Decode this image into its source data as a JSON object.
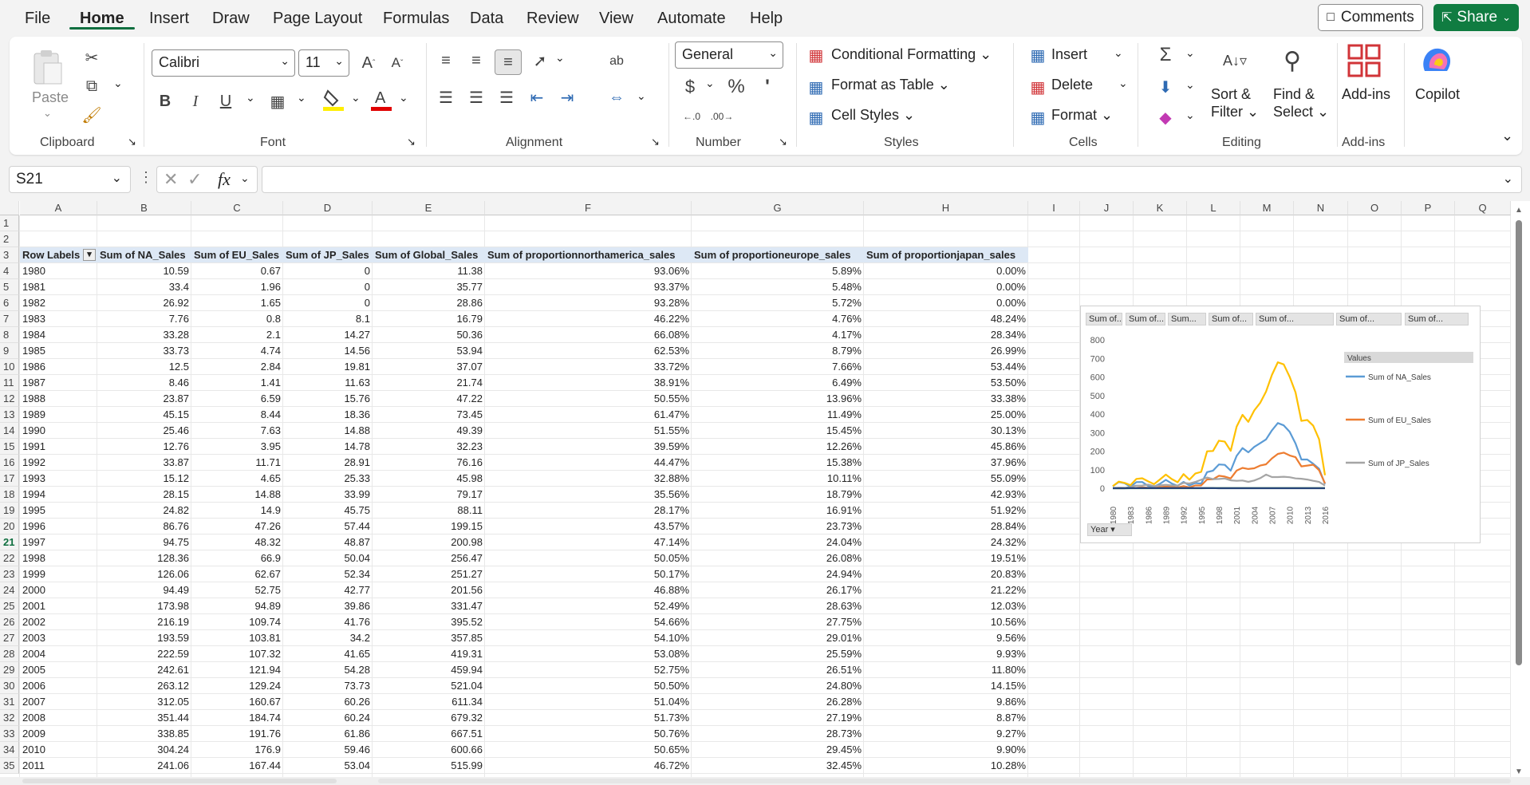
{
  "menu": {
    "tabs": [
      "File",
      "Home",
      "Insert",
      "Draw",
      "Page Layout",
      "Formulas",
      "Data",
      "Review",
      "View",
      "Automate",
      "Help"
    ],
    "active": "Home",
    "comments": "Comments",
    "share": "Share"
  },
  "ribbon": {
    "clipboard": {
      "paste": "Paste",
      "group": "Clipboard"
    },
    "font": {
      "name": "Calibri",
      "size": "11",
      "group": "Font"
    },
    "alignment": {
      "group": "Alignment"
    },
    "number": {
      "format": "General",
      "group": "Number"
    },
    "styles": {
      "conditional": "Conditional Formatting",
      "table": "Format as Table",
      "cell": "Cell Styles",
      "group": "Styles"
    },
    "cells": {
      "insert": "Insert",
      "delete": "Delete",
      "format": "Format",
      "group": "Cells"
    },
    "editing": {
      "sort1": "Sort &",
      "sort2": "Filter",
      "find1": "Find &",
      "find2": "Select",
      "group": "Editing"
    },
    "addins": {
      "label": "Add-ins",
      "group": "Add-ins"
    },
    "copilot": {
      "label": "Copilot"
    }
  },
  "formula_bar": {
    "name_box": "S21",
    "fx": "fx",
    "value": ""
  },
  "columns": [
    "A",
    "B",
    "C",
    "D",
    "E",
    "F",
    "G",
    "H",
    "I",
    "J",
    "K",
    "L",
    "M",
    "N",
    "O",
    "P",
    "Q"
  ],
  "pivot": {
    "header": [
      "Row Labels",
      "Sum of NA_Sales",
      "Sum of EU_Sales",
      "Sum of JP_Sales",
      "Sum of Global_Sales",
      "Sum of proportionnorthamerica_sales",
      "Sum of proportioneurope_sales",
      "Sum of proportionjapan_sales"
    ],
    "rows": [
      [
        "1980",
        "10.59",
        "0.67",
        "0",
        "11.38",
        "93.06%",
        "5.89%",
        "0.00%"
      ],
      [
        "1981",
        "33.4",
        "1.96",
        "0",
        "35.77",
        "93.37%",
        "5.48%",
        "0.00%"
      ],
      [
        "1982",
        "26.92",
        "1.65",
        "0",
        "28.86",
        "93.28%",
        "5.72%",
        "0.00%"
      ],
      [
        "1983",
        "7.76",
        "0.8",
        "8.1",
        "16.79",
        "46.22%",
        "4.76%",
        "48.24%"
      ],
      [
        "1984",
        "33.28",
        "2.1",
        "14.27",
        "50.36",
        "66.08%",
        "4.17%",
        "28.34%"
      ],
      [
        "1985",
        "33.73",
        "4.74",
        "14.56",
        "53.94",
        "62.53%",
        "8.79%",
        "26.99%"
      ],
      [
        "1986",
        "12.5",
        "2.84",
        "19.81",
        "37.07",
        "33.72%",
        "7.66%",
        "53.44%"
      ],
      [
        "1987",
        "8.46",
        "1.41",
        "11.63",
        "21.74",
        "38.91%",
        "6.49%",
        "53.50%"
      ],
      [
        "1988",
        "23.87",
        "6.59",
        "15.76",
        "47.22",
        "50.55%",
        "13.96%",
        "33.38%"
      ],
      [
        "1989",
        "45.15",
        "8.44",
        "18.36",
        "73.45",
        "61.47%",
        "11.49%",
        "25.00%"
      ],
      [
        "1990",
        "25.46",
        "7.63",
        "14.88",
        "49.39",
        "51.55%",
        "15.45%",
        "30.13%"
      ],
      [
        "1991",
        "12.76",
        "3.95",
        "14.78",
        "32.23",
        "39.59%",
        "12.26%",
        "45.86%"
      ],
      [
        "1992",
        "33.87",
        "11.71",
        "28.91",
        "76.16",
        "44.47%",
        "15.38%",
        "37.96%"
      ],
      [
        "1993",
        "15.12",
        "4.65",
        "25.33",
        "45.98",
        "32.88%",
        "10.11%",
        "55.09%"
      ],
      [
        "1994",
        "28.15",
        "14.88",
        "33.99",
        "79.17",
        "35.56%",
        "18.79%",
        "42.93%"
      ],
      [
        "1995",
        "24.82",
        "14.9",
        "45.75",
        "88.11",
        "28.17%",
        "16.91%",
        "51.92%"
      ],
      [
        "1996",
        "86.76",
        "47.26",
        "57.44",
        "199.15",
        "43.57%",
        "23.73%",
        "28.84%"
      ],
      [
        "1997",
        "94.75",
        "48.32",
        "48.87",
        "200.98",
        "47.14%",
        "24.04%",
        "24.32%"
      ],
      [
        "1998",
        "128.36",
        "66.9",
        "50.04",
        "256.47",
        "50.05%",
        "26.08%",
        "19.51%"
      ],
      [
        "1999",
        "126.06",
        "62.67",
        "52.34",
        "251.27",
        "50.17%",
        "24.94%",
        "20.83%"
      ],
      [
        "2000",
        "94.49",
        "52.75",
        "42.77",
        "201.56",
        "46.88%",
        "26.17%",
        "21.22%"
      ],
      [
        "2001",
        "173.98",
        "94.89",
        "39.86",
        "331.47",
        "52.49%",
        "28.63%",
        "12.03%"
      ],
      [
        "2002",
        "216.19",
        "109.74",
        "41.76",
        "395.52",
        "54.66%",
        "27.75%",
        "10.56%"
      ],
      [
        "2003",
        "193.59",
        "103.81",
        "34.2",
        "357.85",
        "54.10%",
        "29.01%",
        "9.56%"
      ],
      [
        "2004",
        "222.59",
        "107.32",
        "41.65",
        "419.31",
        "53.08%",
        "25.59%",
        "9.93%"
      ],
      [
        "2005",
        "242.61",
        "121.94",
        "54.28",
        "459.94",
        "52.75%",
        "26.51%",
        "11.80%"
      ],
      [
        "2006",
        "263.12",
        "129.24",
        "73.73",
        "521.04",
        "50.50%",
        "24.80%",
        "14.15%"
      ],
      [
        "2007",
        "312.05",
        "160.67",
        "60.26",
        "611.34",
        "51.04%",
        "26.28%",
        "9.86%"
      ],
      [
        "2008",
        "351.44",
        "184.74",
        "60.24",
        "679.32",
        "51.73%",
        "27.19%",
        "8.87%"
      ],
      [
        "2009",
        "338.85",
        "191.76",
        "61.86",
        "667.51",
        "50.76%",
        "28.73%",
        "9.27%"
      ],
      [
        "2010",
        "304.24",
        "176.9",
        "59.46",
        "600.66",
        "50.65%",
        "29.45%",
        "9.90%"
      ],
      [
        "2011",
        "241.06",
        "167.44",
        "53.04",
        "515.99",
        "46.72%",
        "32.45%",
        "10.28%"
      ]
    ]
  },
  "chart_data": {
    "type": "line",
    "field_buttons": [
      "Sum of...",
      "Sum of...",
      "Sum...",
      "Sum of...",
      "Sum of...",
      "Sum of...",
      "Sum of..."
    ],
    "legend_title": "Values",
    "axis_button": "Year",
    "yticks": [
      0,
      100,
      200,
      300,
      400,
      500,
      600,
      700,
      800
    ],
    "ylim": [
      0,
      800
    ],
    "xtick_labels": [
      "1980",
      "1983",
      "1986",
      "1989",
      "1992",
      "1995",
      "1998",
      "2001",
      "2004",
      "2007",
      "2010",
      "2013",
      "2016"
    ],
    "x": [
      1980,
      1981,
      1982,
      1983,
      1984,
      1985,
      1986,
      1987,
      1988,
      1989,
      1990,
      1991,
      1992,
      1993,
      1994,
      1995,
      1996,
      1997,
      1998,
      1999,
      2000,
      2001,
      2002,
      2003,
      2004,
      2005,
      2006,
      2007,
      2008,
      2009,
      2010,
      2011,
      2012,
      2013,
      2014,
      2015,
      2016
    ],
    "series": [
      {
        "name": "Sum of NA_Sales",
        "color": "#5b9bd5",
        "values": [
          10.59,
          33.4,
          26.92,
          7.76,
          33.28,
          33.73,
          12.5,
          8.46,
          23.87,
          45.15,
          25.46,
          12.76,
          33.87,
          15.12,
          28.15,
          24.82,
          86.76,
          94.75,
          128.36,
          126.06,
          94.49,
          173.98,
          216.19,
          193.59,
          222.59,
          242.61,
          263.12,
          312.05,
          351.44,
          338.85,
          304.24,
          241.06,
          155,
          155,
          132,
          105,
          23
        ]
      },
      {
        "name": "Sum of EU_Sales",
        "color": "#ed7d31",
        "values": [
          0.67,
          1.96,
          1.65,
          0.8,
          2.1,
          4.74,
          2.84,
          1.41,
          6.59,
          8.44,
          7.63,
          3.95,
          11.71,
          4.65,
          14.88,
          14.9,
          47.26,
          48.32,
          66.9,
          62.67,
          52.75,
          94.89,
          109.74,
          103.81,
          107.32,
          121.94,
          129.24,
          160.67,
          184.74,
          191.76,
          176.9,
          167.44,
          118,
          122,
          127,
          97,
          26
        ]
      },
      {
        "name": "Sum of JP_Sales",
        "color": "#a5a5a5",
        "values": [
          0,
          0,
          0,
          8.1,
          14.27,
          14.56,
          19.81,
          11.63,
          15.76,
          18.36,
          14.88,
          14.78,
          28.91,
          25.33,
          33.99,
          45.75,
          57.44,
          48.87,
          50.04,
          52.34,
          42.77,
          39.86,
          41.76,
          34.2,
          41.65,
          54.28,
          73.73,
          60.26,
          60.24,
          61.86,
          59.46,
          53.04,
          51,
          47,
          40,
          34,
          14
        ]
      },
      {
        "name": "Sum of Global_Sales",
        "color": "#ffc000",
        "values": [
          11.38,
          35.77,
          28.86,
          16.79,
          50.36,
          53.94,
          37.07,
          21.74,
          47.22,
          73.45,
          49.39,
          32.23,
          76.16,
          45.98,
          79.17,
          88.11,
          199.15,
          200.98,
          256.47,
          251.27,
          201.56,
          331.47,
          395.52,
          357.85,
          419.31,
          459.94,
          521.04,
          611.34,
          679.32,
          667.51,
          600.66,
          515.99,
          363,
          368,
          337,
          264,
          70
        ]
      },
      {
        "name": "Sum of proportionnorthamerica_sales",
        "color": "#4472c4",
        "values": [
          0.93,
          0.93,
          0.93,
          0.46,
          0.66,
          0.63,
          0.34,
          0.39,
          0.51,
          0.61,
          0.52,
          0.4,
          0.44,
          0.33,
          0.36,
          0.28,
          0.44,
          0.47,
          0.5,
          0.5,
          0.47,
          0.52,
          0.55,
          0.54,
          0.53,
          0.53,
          0.51,
          0.51,
          0.52,
          0.51,
          0.51,
          0.47,
          0.43,
          0.42,
          0.39,
          0.4,
          0.33
        ]
      },
      {
        "name": "Sum of proportioneurope_sales",
        "color": "#70ad47",
        "values": [
          0.06,
          0.05,
          0.06,
          0.05,
          0.04,
          0.09,
          0.08,
          0.06,
          0.14,
          0.11,
          0.15,
          0.12,
          0.15,
          0.1,
          0.19,
          0.17,
          0.24,
          0.24,
          0.26,
          0.25,
          0.26,
          0.29,
          0.28,
          0.29,
          0.26,
          0.27,
          0.25,
          0.26,
          0.27,
          0.29,
          0.29,
          0.32,
          0.33,
          0.33,
          0.38,
          0.37,
          0.37
        ]
      },
      {
        "name": "Sum of proportionjapan_sales",
        "color": "#264478",
        "values": [
          0,
          0,
          0,
          0.48,
          0.28,
          0.27,
          0.53,
          0.54,
          0.33,
          0.25,
          0.3,
          0.46,
          0.38,
          0.55,
          0.43,
          0.52,
          0.29,
          0.24,
          0.2,
          0.21,
          0.21,
          0.12,
          0.11,
          0.1,
          0.1,
          0.12,
          0.14,
          0.1,
          0.09,
          0.09,
          0.1,
          0.1,
          0.14,
          0.13,
          0.12,
          0.13,
          0.2
        ]
      }
    ],
    "legend_shown": [
      "Sum of NA_Sales",
      "Sum of EU_Sales",
      "Sum of JP_Sales"
    ]
  },
  "colors": {
    "accent": "#107c41",
    "header_fill": "#dde8f5"
  }
}
